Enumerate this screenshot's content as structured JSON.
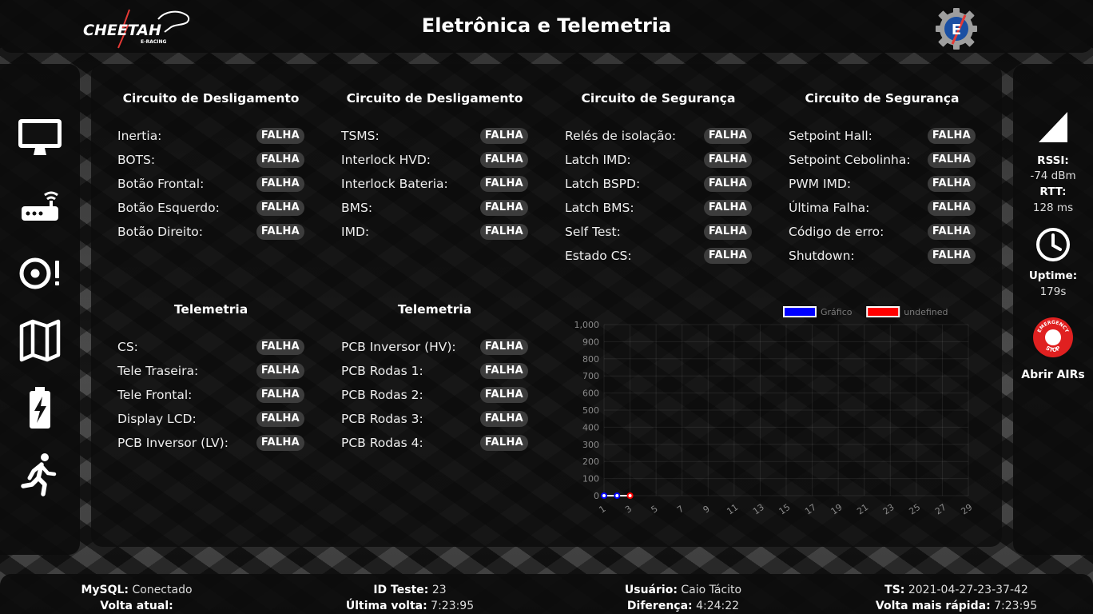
{
  "header": {
    "logo_text": "CHEETAH",
    "logo_sub": "E-RACING",
    "title": "Eletrônica e Telemetria",
    "team_logo_letter": "E"
  },
  "sidebar": {
    "items": [
      {
        "icon": "monitor-icon"
      },
      {
        "icon": "router-icon"
      },
      {
        "icon": "brake-warning-icon"
      },
      {
        "icon": "map-icon"
      },
      {
        "icon": "battery-bolt-icon"
      },
      {
        "icon": "running-person-icon"
      }
    ]
  },
  "sections": [
    {
      "title": "Circuito de Desligamento",
      "rows": [
        {
          "label": "Inertia:",
          "status": "FALHA"
        },
        {
          "label": "BOTS:",
          "status": "FALHA"
        },
        {
          "label": "Botão Frontal:",
          "status": "FALHA"
        },
        {
          "label": "Botão Esquerdo:",
          "status": "FALHA"
        },
        {
          "label": "Botão Direito:",
          "status": "FALHA"
        }
      ]
    },
    {
      "title": "Circuito de Desligamento",
      "rows": [
        {
          "label": "TSMS:",
          "status": "FALHA"
        },
        {
          "label": "Interlock HVD:",
          "status": "FALHA"
        },
        {
          "label": "Interlock Bateria:",
          "status": "FALHA"
        },
        {
          "label": "BMS:",
          "status": "FALHA"
        },
        {
          "label": "IMD:",
          "status": "FALHA"
        }
      ]
    },
    {
      "title": "Circuito de Segurança",
      "rows": [
        {
          "label": "Relés de isolação:",
          "status": "FALHA"
        },
        {
          "label": "Latch IMD:",
          "status": "FALHA"
        },
        {
          "label": "Latch BSPD:",
          "status": "FALHA"
        },
        {
          "label": "Latch BMS:",
          "status": "FALHA"
        },
        {
          "label": "Self Test:",
          "status": "FALHA"
        },
        {
          "label": "Estado CS:",
          "status": "FALHA"
        }
      ]
    },
    {
      "title": "Circuito de Segurança",
      "rows": [
        {
          "label": "Setpoint Hall:",
          "status": "FALHA"
        },
        {
          "label": "Setpoint Cebolinha:",
          "status": "FALHA"
        },
        {
          "label": "PWM IMD:",
          "status": "FALHA"
        },
        {
          "label": "Última Falha:",
          "status": "FALHA"
        },
        {
          "label": "Código de erro:",
          "status": "FALHA"
        },
        {
          "label": "Shutdown:",
          "status": "FALHA"
        }
      ]
    },
    {
      "title": "Telemetria",
      "rows": [
        {
          "label": "CS:",
          "status": "FALHA"
        },
        {
          "label": "Tele Traseira:",
          "status": "FALHA"
        },
        {
          "label": "Tele Frontal:",
          "status": "FALHA"
        },
        {
          "label": "Display LCD:",
          "status": "FALHA"
        },
        {
          "label": "PCB Inversor (LV):",
          "status": "FALHA"
        }
      ]
    },
    {
      "title": "Telemetria",
      "rows": [
        {
          "label": "PCB Inversor (HV):",
          "status": "FALHA"
        },
        {
          "label": "PCB Rodas 1:",
          "status": "FALHA"
        },
        {
          "label": "PCB Rodas 2:",
          "status": "FALHA"
        },
        {
          "label": "PCB Rodas 3:",
          "status": "FALHA"
        },
        {
          "label": "PCB Rodas 4:",
          "status": "FALHA"
        }
      ]
    }
  ],
  "chart_data": {
    "type": "line",
    "x": [
      1,
      2,
      3
    ],
    "x_ticks": [
      "1",
      "3",
      "5",
      "7",
      "9",
      "11",
      "13",
      "15",
      "17",
      "19",
      "21",
      "23",
      "25",
      "27",
      "29"
    ],
    "y_ticks": [
      "0",
      "100",
      "200",
      "300",
      "400",
      "500",
      "600",
      "700",
      "800",
      "900",
      "1,000"
    ],
    "ylim": [
      0,
      1000
    ],
    "xlim": [
      1,
      29
    ],
    "grid": true,
    "legend_position": "top",
    "series": [
      {
        "name": "Gráfico",
        "color": "#0000ff",
        "x": [
          1,
          2
        ],
        "values": [
          0,
          0
        ]
      },
      {
        "name": "undefined",
        "color": "#ff0000",
        "x": [
          3
        ],
        "values": [
          0
        ]
      }
    ]
  },
  "right_panel": {
    "rssi_label": "RSSI:",
    "rssi_value": "-74 dBm",
    "rtt_label": "RTT:",
    "rtt_value": "128 ms",
    "uptime_label": "Uptime:",
    "uptime_value": "179s",
    "estop_text_top": "EMERGENCY",
    "estop_text_bottom": "STOP",
    "estop_label": "Abrir AIRs"
  },
  "footer": {
    "mysql_label": "MySQL:",
    "mysql_value": "Conectado",
    "volta_atual_label": "Volta atual:",
    "volta_atual_value": "",
    "id_teste_label": "ID Teste:",
    "id_teste_value": "23",
    "ultima_volta_label": "Última volta:",
    "ultima_volta_value": "7:23:95",
    "usuario_label": "Usuário:",
    "usuario_value": "Caio Tácito",
    "diferenca_label": "Diferença:",
    "diferenca_value": "4:24:22",
    "ts_label": "TS:",
    "ts_value": "2021-04-27-23-37-42",
    "volta_rapida_label": "Volta mais rápida:",
    "volta_rapida_value": "7:23:95"
  }
}
